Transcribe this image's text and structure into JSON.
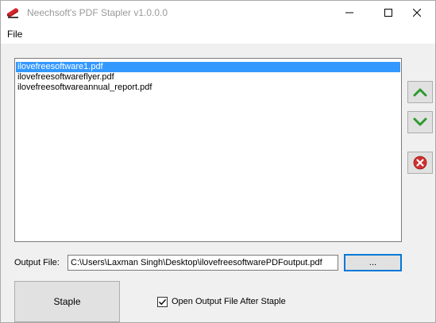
{
  "window": {
    "title": "Neechsoft's PDF Stapler v1.0.0.0"
  },
  "menu": {
    "file": "File"
  },
  "file_list": {
    "items": [
      {
        "label": "ilovefreesoftware1.pdf",
        "selected": true
      },
      {
        "label": "ilovefreesoftwareflyer.pdf",
        "selected": false
      },
      {
        "label": "ilovefreesoftwareannual_report.pdf",
        "selected": false
      }
    ]
  },
  "side_buttons": {
    "up_icon": "arrow-up-icon",
    "down_icon": "arrow-down-icon",
    "remove_icon": "remove-icon"
  },
  "output": {
    "label": "Output File:",
    "value": "C:\\Users\\Laxman Singh\\Desktop\\ilovefreesoftwarePDFoutput.pdf",
    "browse_label": "..."
  },
  "actions": {
    "staple_label": "Staple",
    "open_after_label": "Open Output File After Staple",
    "open_after_checked": true
  },
  "colors": {
    "selection": "#3399ff",
    "arrow_green": "#2e9a2e",
    "remove_red": "#d32f2f",
    "focus_border": "#0078d7"
  }
}
